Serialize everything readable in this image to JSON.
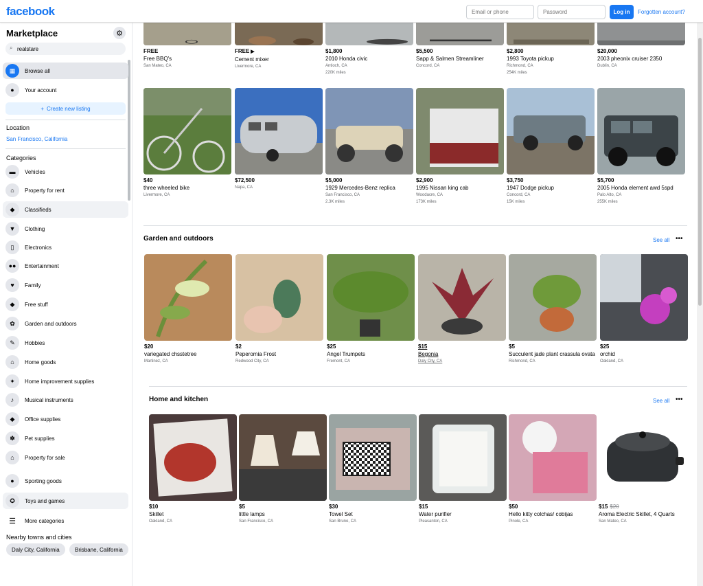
{
  "topbar": {
    "logo": "facebook",
    "email_placeholder": "Email or phone",
    "password_placeholder": "Password",
    "login_label": "Log in",
    "forgot_label": "Forgotten account?"
  },
  "sidebar": {
    "title": "Marketplace",
    "search_value": "realstare",
    "browse_all": "Browse all",
    "your_account": "Your account",
    "create_listing": "Create new listing",
    "location_heading": "Location",
    "location_value": "San Francisco, California",
    "categories_heading": "Categories",
    "categories": [
      {
        "label": "Vehicles",
        "icon": "car-icon"
      },
      {
        "label": "Property for rent",
        "icon": "house-icon"
      },
      {
        "label": "Classifieds",
        "icon": "tag-icon"
      },
      {
        "label": "Clothing",
        "icon": "shirt-icon"
      },
      {
        "label": "Electronics",
        "icon": "phone-icon"
      },
      {
        "label": "Entertainment",
        "icon": "people-icon"
      },
      {
        "label": "Family",
        "icon": "heart-icon"
      },
      {
        "label": "Free stuff",
        "icon": "tag-icon"
      },
      {
        "label": "Garden and outdoors",
        "icon": "plant-icon"
      },
      {
        "label": "Hobbies",
        "icon": "hobby-icon"
      },
      {
        "label": "Home goods",
        "icon": "house-icon"
      },
      {
        "label": "Home improvement supplies",
        "icon": "wrench-icon"
      },
      {
        "label": "Musical instruments",
        "icon": "guitar-icon"
      },
      {
        "label": "Office supplies",
        "icon": "tag-icon"
      },
      {
        "label": "Pet supplies",
        "icon": "paw-icon"
      },
      {
        "label": "Property for sale",
        "icon": "house-icon"
      },
      {
        "label": "Sporting goods",
        "icon": "ball-icon"
      },
      {
        "label": "Toys and games",
        "icon": "toy-icon"
      },
      {
        "label": "More categories",
        "icon": "list-icon"
      }
    ],
    "nearby_heading": "Nearby towns and cities",
    "nearby": [
      "Daly City, California",
      "Brisbane, California"
    ]
  },
  "listings_top": [
    {
      "price": "FREE",
      "title": "Free BBQ's",
      "loc": "San Mateo, CA",
      "miles": "",
      "video": false
    },
    {
      "price": "FREE",
      "title": "Cement mixer",
      "loc": "Livermore, CA",
      "miles": "",
      "video": true
    },
    {
      "price": "$1,800",
      "title": "2010 Honda civic",
      "loc": "Antioch, CA",
      "miles": "220K miles",
      "video": false
    },
    {
      "price": "$5,500",
      "title": "Sapp & Salmen Streamliner",
      "loc": "Concord, CA",
      "miles": "",
      "video": false
    },
    {
      "price": "$2,800",
      "title": "1993 Toyota pickup",
      "loc": "Richmond, CA",
      "miles": "254K miles",
      "video": false
    },
    {
      "price": "$20,000",
      "title": "2003 pheonix cruiser 2350",
      "loc": "Dublin, CA",
      "miles": "",
      "video": false
    }
  ],
  "listings_vehicles": [
    {
      "price": "$40",
      "title": "three wheeled bike",
      "loc": "Livermore, CA",
      "miles": ""
    },
    {
      "price": "$72,500",
      "title": "",
      "loc": "Napa, CA",
      "miles": ""
    },
    {
      "price": "$5,000",
      "title": "1929 Mercedes-Benz replica",
      "loc": "San Francisco, CA",
      "miles": "2.3K miles"
    },
    {
      "price": "$2,900",
      "title": "1995 Nissan king cab",
      "loc": "Woodacre, CA",
      "miles": "173K miles"
    },
    {
      "price": "$3,750",
      "title": "1947 Dodge pickup",
      "loc": "Concord, CA",
      "miles": "15K miles"
    },
    {
      "price": "$5,700",
      "title": "2005 Honda element awd 5spd",
      "loc": "Palo Alto, CA",
      "miles": "255K miles"
    }
  ],
  "garden": {
    "title": "Garden and outdoors",
    "see_all": "See all",
    "more": "•••",
    "items": [
      {
        "price": "$20",
        "title": "variegated chsstetree",
        "loc": "Martinez, CA"
      },
      {
        "price": "$2",
        "title": "Peperomia Frost",
        "loc": "Redwood City, CA"
      },
      {
        "price": "$25",
        "title": "Angel Trumpets",
        "loc": "Fremont, CA"
      },
      {
        "price": "$15",
        "title": "Begonia",
        "loc": "Daly City, CA"
      },
      {
        "price": "$5",
        "title": "Succulent jade plant crassula ovata",
        "loc": "Richmond, CA"
      },
      {
        "price": "$25",
        "title": "orchid",
        "loc": "Oakland, CA"
      }
    ]
  },
  "kitchen": {
    "title": "Home and kitchen",
    "see_all": "See all",
    "more": "•••",
    "items": [
      {
        "price": "$10",
        "old": "",
        "title": "Skillet",
        "loc": "Oakland, CA"
      },
      {
        "price": "$5",
        "old": "",
        "title": "little lamps",
        "loc": "San Francisco, CA"
      },
      {
        "price": "$30",
        "old": "",
        "title": "Towel Set",
        "loc": "San Bruno, CA"
      },
      {
        "price": "$15",
        "old": "",
        "title": "Water purifier",
        "loc": "Pleasanton, CA"
      },
      {
        "price": "$50",
        "old": "",
        "title": "Hello kitty colchas/ cobijas",
        "loc": "Pinole, CA"
      },
      {
        "price": "$15",
        "old": "$20",
        "title": "Aroma Electric Skillet, 4 Quarts",
        "loc": "San Mateo, CA"
      }
    ]
  }
}
